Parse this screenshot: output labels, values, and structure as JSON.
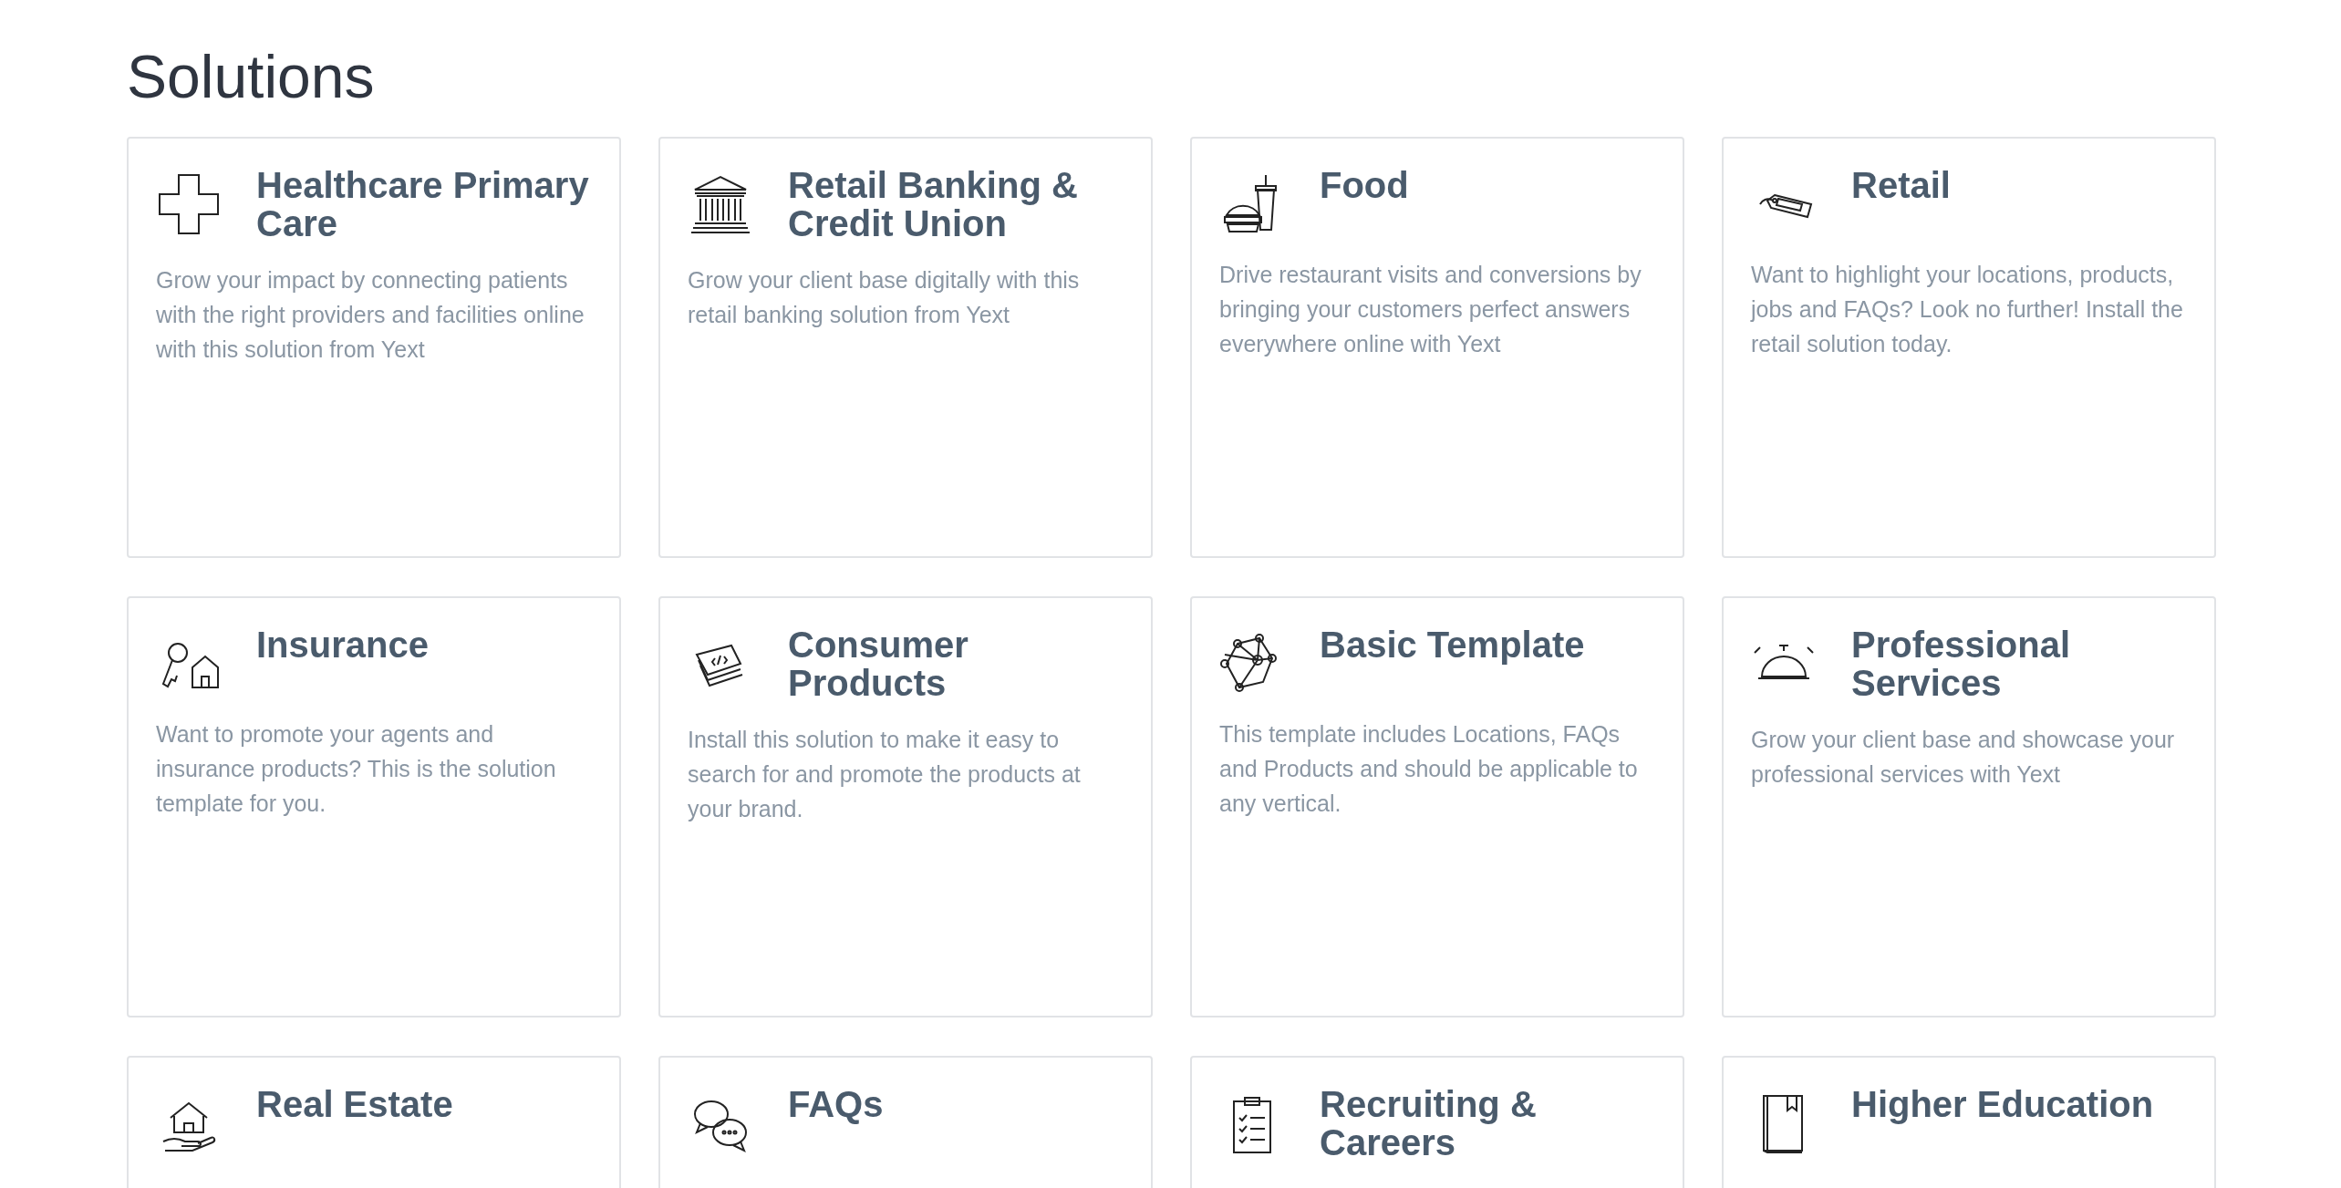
{
  "page_title": "Solutions",
  "solutions": [
    {
      "title": "Healthcare Primary Care",
      "description": "Grow your impact by connecting patients with the right providers and facilities online with this solution from Yext"
    },
    {
      "title": "Retail Banking & Credit Union",
      "description": "Grow your client base digitally with this retail banking solution from Yext"
    },
    {
      "title": "Food",
      "description": "Drive restaurant visits and conversions by bringing your customers perfect answers everywhere online with Yext"
    },
    {
      "title": "Retail",
      "description": "Want to highlight your locations, products, jobs and FAQs? Look no further! Install the retail solution today."
    },
    {
      "title": "Insurance",
      "description": "Want to promote your agents and insurance products? This is the solution template for you."
    },
    {
      "title": "Consumer Products",
      "description": "Install this solution to make it easy to search for and promote the products at your brand."
    },
    {
      "title": "Basic Template",
      "description": "This template includes Locations, FAQs and Products and should be applicable to any vertical."
    },
    {
      "title": "Professional Services",
      "description": "Grow your client base and showcase your professional services with Yext"
    },
    {
      "title": "Real Estate"
    },
    {
      "title": "FAQs"
    },
    {
      "title": "Recruiting & Careers"
    },
    {
      "title": "Higher Education"
    }
  ]
}
